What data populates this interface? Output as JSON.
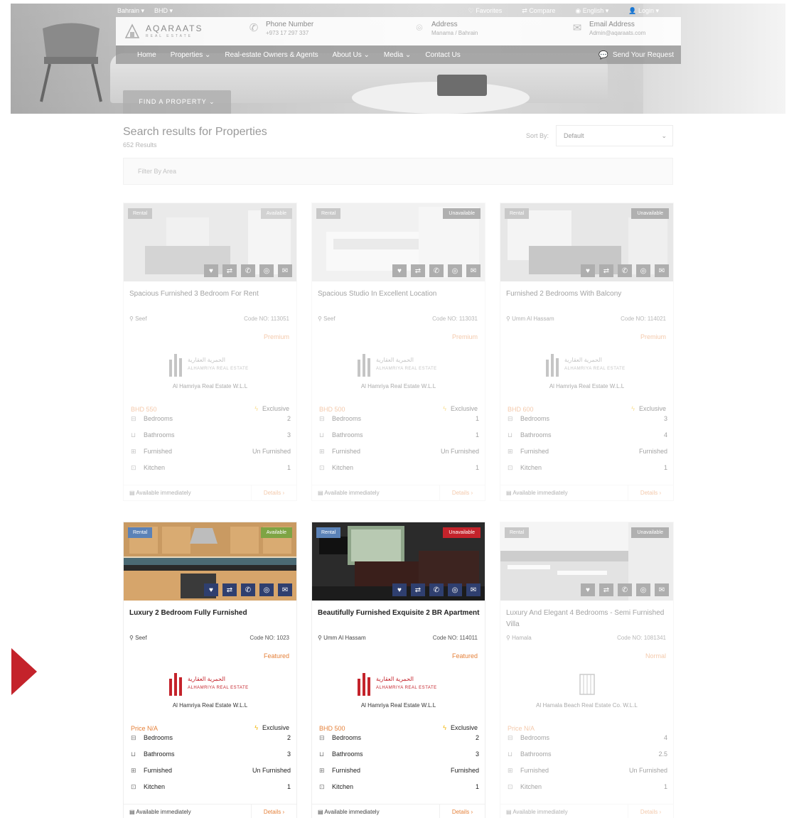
{
  "topbar": {
    "currency": "Bahrain ▾",
    "currency2": "BHD ▾",
    "favorites": "Favorites",
    "compare": "Compare",
    "language": "English ▾",
    "login": "Login ▾"
  },
  "brand": {
    "name": "AQARAATS",
    "sub": "REAL ESTATE"
  },
  "contacts": {
    "phone_label": "Phone Number",
    "phone_value": "+973 17 297 337",
    "address_label": "Address",
    "address_value": "Manama / Bahrain",
    "email_label": "Email Address",
    "email_value": "Admin@aqaraats.com"
  },
  "nav": {
    "home": "Home",
    "properties": "Properties ⌄",
    "owners": "Real-estate Owners & Agents",
    "about": "About Us ⌄",
    "media": "Media ⌄",
    "contact": "Contact Us",
    "send": "Send Your Request"
  },
  "find_btn": "FIND A PROPERTY ⌄",
  "results": {
    "title": "Search results for Properties",
    "count": "652 Results",
    "sort_label": "Sort By:",
    "sort_value": "Default",
    "filter_placeholder": "Filter By Area"
  },
  "cards": [
    {
      "type": "Rental",
      "status": "Available",
      "status_kind": "available",
      "title": "Spacious Furnished 3 Bedroom For Rent",
      "location": "Seef",
      "code": "Code NO: 113051",
      "badge": "Premium",
      "agency": "Al Hamriya Real Estate W.L.L",
      "price": "BHD 550",
      "exclusive": "Exclusive",
      "bedrooms": "2",
      "bathrooms": "3",
      "furnished": "Un Furnished",
      "kitchen": "1",
      "available": "Available immediately",
      "details": "Details ›"
    },
    {
      "type": "Rental",
      "status": "Unavailable",
      "status_kind": "unavailable",
      "title": "Spacious Studio In Excellent Location",
      "location": "Seef",
      "code": "Code NO: 113031",
      "badge": "Premium",
      "agency": "Al Hamriya Real Estate W.L.L",
      "price": "BHD 500",
      "exclusive": "Exclusive",
      "bedrooms": "1",
      "bathrooms": "1",
      "furnished": "Un Furnished",
      "kitchen": "1",
      "available": "Available immediately",
      "details": "Details ›"
    },
    {
      "type": "Rental",
      "status": "Unavailable",
      "status_kind": "unavailable",
      "title": "Furnished 2 Bedrooms With Balcony",
      "location": "Umm Al Hassam",
      "code": "Code NO: 114021",
      "badge": "Premium",
      "agency": "Al Hamriya Real Estate W.L.L",
      "price": "BHD 600",
      "exclusive": "Exclusive",
      "bedrooms": "3",
      "bathrooms": "4",
      "furnished": "Furnished",
      "kitchen": "1",
      "available": "Available immediately",
      "details": "Details ›"
    },
    {
      "type": "Rental",
      "status": "Available",
      "status_kind": "available",
      "title": "Luxury 2 Bedroom Fully Furnished",
      "location": "Seef",
      "code": "Code NO: 1023",
      "badge": "Featured",
      "agency": "Al Hamriya Real Estate W.L.L",
      "price": "Price N/A",
      "exclusive": "Exclusive",
      "bedrooms": "2",
      "bathrooms": "3",
      "furnished": "Un Furnished",
      "kitchen": "1",
      "available": "Available immediately",
      "details": "Details ›"
    },
    {
      "type": "Rental",
      "status": "Unavailable",
      "status_kind": "unavailable",
      "title": "Beautifully Furnished Exquisite 2 BR Apartment",
      "location": "Umm Al Hassam",
      "code": "Code NO: 114011",
      "badge": "Featured",
      "agency": "Al Hamriya Real Estate W.L.L",
      "price": "BHD 500",
      "exclusive": "Exclusive",
      "bedrooms": "2",
      "bathrooms": "3",
      "furnished": "Furnished",
      "kitchen": "1",
      "available": "Available immediately",
      "details": "Details ›"
    },
    {
      "type": "Rental",
      "status": "Unavailable",
      "status_kind": "unavailable",
      "title": "Luxury And Elegant 4 Bedrooms - Semi Furnished Villa",
      "location": "Hamala",
      "code": "Code NO: 1081341",
      "badge": "Normal",
      "agency": "Al Hamala Beach Real Estate Co. W.L.L",
      "price": "Price N/A",
      "exclusive": "",
      "bedrooms": "4",
      "bathrooms": "2.5",
      "furnished": "Un Furnished",
      "kitchen": "1",
      "available": "Available immediately",
      "details": "Details ›"
    }
  ],
  "spec_labels": {
    "bedrooms": "Bedrooms",
    "bathrooms": "Bathrooms",
    "furnished": "Furnished",
    "kitchen": "Kitchen"
  },
  "agency_logo_text": {
    "arabic": "الحمرية العقارية",
    "latin": "ALHAMRIYA REAL ESTATE"
  },
  "colors": {
    "rental_tag": "#5b82b7",
    "available": "#7ea444",
    "unavailable": "#c4232b",
    "accent": "#e5813a",
    "action_btn": "#2f3f6f",
    "arrow": "#c4232b"
  }
}
